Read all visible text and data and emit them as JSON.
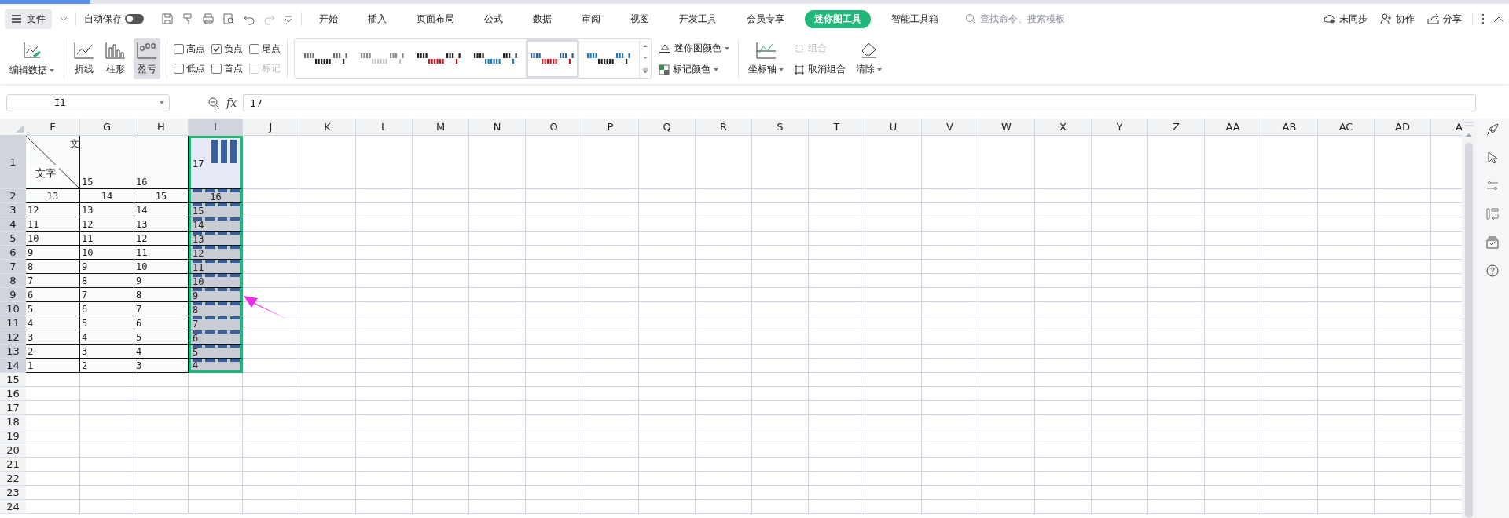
{
  "menubar": {
    "file_menu": "文件",
    "autosave_label": "自动保存",
    "autosave_on": false,
    "tabs": [
      {
        "label": "开始",
        "selected": false
      },
      {
        "label": "插入",
        "selected": false
      },
      {
        "label": "页面布局",
        "selected": false
      },
      {
        "label": "公式",
        "selected": false
      },
      {
        "label": "数据",
        "selected": false
      },
      {
        "label": "审阅",
        "selected": false
      },
      {
        "label": "视图",
        "selected": false
      },
      {
        "label": "开发工具",
        "selected": false
      },
      {
        "label": "会员专享",
        "selected": false
      },
      {
        "label": "迷你图工具",
        "selected": true
      },
      {
        "label": "智能工具箱",
        "selected": false
      }
    ],
    "search": {
      "placeholder": "查找命令、搜索模板"
    },
    "actions": [
      {
        "kind": "sync",
        "label": "未同步"
      },
      {
        "kind": "collab",
        "label": "协作"
      },
      {
        "kind": "share",
        "label": "分享"
      }
    ]
  },
  "ribbon": {
    "edit_data": "编辑数据",
    "types": [
      {
        "kind": "line",
        "label": "折线",
        "selected": false
      },
      {
        "kind": "column",
        "label": "柱形",
        "selected": false
      },
      {
        "kind": "winloss",
        "label": "盈亏",
        "selected": true
      }
    ],
    "points": [
      {
        "label": "高点",
        "checked": false,
        "disabled": false
      },
      {
        "label": "负点",
        "checked": true,
        "disabled": false
      },
      {
        "label": "尾点",
        "checked": false,
        "disabled": false
      },
      {
        "label": "低点",
        "checked": false,
        "disabled": false
      },
      {
        "label": "首点",
        "checked": false,
        "disabled": false
      },
      {
        "label": "标记",
        "checked": false,
        "disabled": true
      }
    ],
    "styles": [
      {
        "kind": "gray",
        "selected": false
      },
      {
        "kind": "light",
        "selected": false
      },
      {
        "kind": "red",
        "selected": false
      },
      {
        "kind": "blue",
        "selected": false
      },
      {
        "kind": "navyred",
        "selected": true
      },
      {
        "kind": "blueblack",
        "selected": false
      }
    ],
    "sparkline_color": "迷你图颜色",
    "marker_color": "标记颜色",
    "axis": "坐标轴",
    "group": {
      "label": "组合",
      "disabled": true
    },
    "ungroup": {
      "label": "取消组合",
      "disabled": false
    },
    "clear": "清除"
  },
  "formula_bar": {
    "name_box": "I1",
    "fx": "fx",
    "value": "17"
  },
  "grid": {
    "columns": [
      {
        "label": "F",
        "selected": false
      },
      {
        "label": "G",
        "selected": false
      },
      {
        "label": "H",
        "selected": false
      },
      {
        "label": "I",
        "selected": true
      },
      {
        "label": "J",
        "selected": false
      },
      {
        "label": "K",
        "selected": false
      },
      {
        "label": "L",
        "selected": false
      },
      {
        "label": "M",
        "selected": false
      },
      {
        "label": "N",
        "selected": false
      },
      {
        "label": "O",
        "selected": false
      },
      {
        "label": "P",
        "selected": false
      },
      {
        "label": "Q",
        "selected": false
      },
      {
        "label": "R",
        "selected": false
      },
      {
        "label": "S",
        "selected": false
      },
      {
        "label": "T",
        "selected": false
      },
      {
        "label": "U",
        "selected": false
      },
      {
        "label": "V",
        "selected": false
      },
      {
        "label": "W",
        "selected": false
      },
      {
        "label": "X",
        "selected": false
      },
      {
        "label": "Y",
        "selected": false
      },
      {
        "label": "Z",
        "selected": false
      },
      {
        "label": "AA",
        "selected": false
      },
      {
        "label": "AB",
        "selected": false
      },
      {
        "label": "AC",
        "selected": false
      },
      {
        "label": "AD",
        "selected": false
      },
      {
        "label": "A",
        "selected": false
      }
    ],
    "rows": [
      {
        "label": "1",
        "selected": true,
        "kind": "plain",
        "cells": [
          {
            "kind": "diagonal",
            "lower": "文字",
            "upper": "文"
          },
          {
            "kind": "text",
            "text": "15"
          },
          {
            "kind": "text",
            "text": "16"
          },
          {
            "kind": "columns",
            "text": "17",
            "active": true
          }
        ]
      },
      {
        "label": "2",
        "selected": true,
        "kind": "centered",
        "cells": [
          {
            "kind": "text",
            "text": "13"
          },
          {
            "kind": "text",
            "text": "14"
          },
          {
            "kind": "text",
            "text": "15"
          },
          {
            "kind": "dashes",
            "text": "16",
            "active": false
          }
        ]
      },
      {
        "label": "3",
        "selected": true,
        "kind": "plain",
        "cells": [
          {
            "kind": "text",
            "text": "12"
          },
          {
            "kind": "text",
            "text": "13"
          },
          {
            "kind": "text",
            "text": "14"
          },
          {
            "kind": "dashes",
            "text": "15",
            "active": false
          }
        ]
      },
      {
        "label": "4",
        "selected": true,
        "kind": "plain",
        "cells": [
          {
            "kind": "text",
            "text": "11"
          },
          {
            "kind": "text",
            "text": "12"
          },
          {
            "kind": "text",
            "text": "13"
          },
          {
            "kind": "dashes",
            "text": "14",
            "active": false
          }
        ]
      },
      {
        "label": "5",
        "selected": true,
        "kind": "plain",
        "cells": [
          {
            "kind": "text",
            "text": "10"
          },
          {
            "kind": "text",
            "text": "11"
          },
          {
            "kind": "text",
            "text": "12"
          },
          {
            "kind": "dashes",
            "text": "13",
            "active": false
          }
        ]
      },
      {
        "label": "6",
        "selected": true,
        "kind": "plain",
        "cells": [
          {
            "kind": "text",
            "text": "9"
          },
          {
            "kind": "text",
            "text": "10"
          },
          {
            "kind": "text",
            "text": "11"
          },
          {
            "kind": "dashes",
            "text": "12",
            "active": false
          }
        ]
      },
      {
        "label": "7",
        "selected": true,
        "kind": "plain",
        "cells": [
          {
            "kind": "text",
            "text": "8"
          },
          {
            "kind": "text",
            "text": "9"
          },
          {
            "kind": "text",
            "text": "10"
          },
          {
            "kind": "dashes",
            "text": "11",
            "active": false
          }
        ]
      },
      {
        "label": "8",
        "selected": true,
        "kind": "plain",
        "cells": [
          {
            "kind": "text",
            "text": "7"
          },
          {
            "kind": "text",
            "text": "8"
          },
          {
            "kind": "text",
            "text": "9"
          },
          {
            "kind": "dashes",
            "text": "10",
            "active": false
          }
        ]
      },
      {
        "label": "9",
        "selected": true,
        "kind": "plain",
        "cells": [
          {
            "kind": "text",
            "text": "6"
          },
          {
            "kind": "text",
            "text": "7"
          },
          {
            "kind": "text",
            "text": "8"
          },
          {
            "kind": "dashes",
            "text": "9",
            "active": false
          }
        ]
      },
      {
        "label": "10",
        "selected": true,
        "kind": "plain",
        "cells": [
          {
            "kind": "text",
            "text": "5"
          },
          {
            "kind": "text",
            "text": "6"
          },
          {
            "kind": "text",
            "text": "7"
          },
          {
            "kind": "dashes",
            "text": "8",
            "active": false
          }
        ]
      },
      {
        "label": "11",
        "selected": true,
        "kind": "plain",
        "cells": [
          {
            "kind": "text",
            "text": "4"
          },
          {
            "kind": "text",
            "text": "5"
          },
          {
            "kind": "text",
            "text": "6"
          },
          {
            "kind": "dashes",
            "text": "7",
            "active": false
          }
        ]
      },
      {
        "label": "12",
        "selected": true,
        "kind": "plain",
        "cells": [
          {
            "kind": "text",
            "text": "3"
          },
          {
            "kind": "text",
            "text": "4"
          },
          {
            "kind": "text",
            "text": "5"
          },
          {
            "kind": "dashes",
            "text": "6",
            "active": false
          }
        ]
      },
      {
        "label": "13",
        "selected": true,
        "kind": "plain",
        "cells": [
          {
            "kind": "text",
            "text": "2"
          },
          {
            "kind": "text",
            "text": "3"
          },
          {
            "kind": "text",
            "text": "4"
          },
          {
            "kind": "dashes",
            "text": "5",
            "active": false
          }
        ]
      },
      {
        "label": "14",
        "selected": true,
        "kind": "plain",
        "cells": [
          {
            "kind": "text",
            "text": "1"
          },
          {
            "kind": "text",
            "text": "2"
          },
          {
            "kind": "text",
            "text": "3"
          },
          {
            "kind": "dashes",
            "text": "4",
            "active": false
          }
        ]
      },
      {
        "label": "15",
        "selected": false,
        "cells": []
      },
      {
        "label": "16",
        "selected": false,
        "cells": []
      },
      {
        "label": "17",
        "selected": false,
        "cells": []
      },
      {
        "label": "18",
        "selected": false,
        "cells": []
      },
      {
        "label": "19",
        "selected": false,
        "cells": []
      },
      {
        "label": "20",
        "selected": false,
        "cells": []
      },
      {
        "label": "21",
        "selected": false,
        "cells": []
      },
      {
        "label": "22",
        "selected": false,
        "cells": []
      },
      {
        "label": "23",
        "selected": false,
        "cells": []
      },
      {
        "label": "24",
        "selected": false,
        "cells": []
      }
    ]
  }
}
